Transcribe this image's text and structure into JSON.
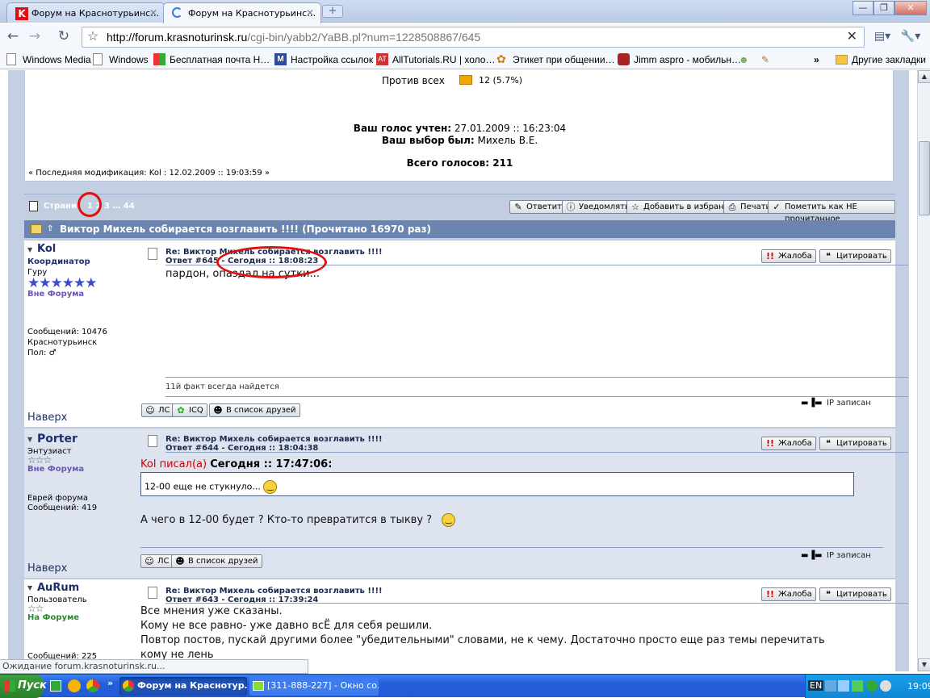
{
  "browser": {
    "tabs": [
      {
        "label": "Форум на Краснотурьинс…",
        "active": false
      },
      {
        "label": "Форум на Краснотурьинс…",
        "active": true
      }
    ],
    "url_host": "http://forum.krasnoturinsk.ru",
    "url_path": "/cgi-bin/yabb2/YaBB.pl?num=1228508867/645",
    "bookmarks": [
      "Windows Media",
      "Windows",
      "Бесплатная почта Н…",
      "Настройка ссылок",
      "AllTutorials.RU | холо…",
      "Этикет при общении…",
      "Jimm aspro - мобильн…",
      "»",
      "Другие закладки"
    ]
  },
  "poll": {
    "option_label": "Против всех",
    "option_value": "12 (5.7%)",
    "option_fraction": 0.057,
    "vote_counted_label": "Ваш голос учтен:",
    "vote_counted_value": "27.01.2009 :: 16:23:04",
    "choice_label": "Ваш выбор был:",
    "choice_value": "Михель В.Е.",
    "total_label": "Всего голосов:",
    "total_value": "211",
    "last_mod": "« Последняя модификация: Kol : 12.02.2009 :: 19:03:59 »"
  },
  "pagenav": {
    "label": "Страни",
    "pages": "1 2 3 … 44",
    "buttons": [
      "Ответить",
      "Уведомлять",
      "Добавить в избранное",
      "Печать",
      "Пометить как НЕ прочитанное"
    ]
  },
  "topic": {
    "title": "Виктор Михель собирается возглавить !!!! (Прочитано 16970 раз)"
  },
  "posts": [
    {
      "user": "Kol",
      "role": "Координатор",
      "rank": "Гуру",
      "status": "Вне Форума",
      "messages": "Сообщений: 10476",
      "city": "Краснотурьинск",
      "gender": "Пол: ♂",
      "title": "Re: Виктор Михель собирается возглавить !!!!",
      "reply": "Ответ #645 - Сегодня :: 18:08:23",
      "body": "пардон, опаздал на сутки...",
      "signature": "11й факт всегда найдется",
      "nav": "Наверх",
      "ip": "IP записан",
      "actions": [
        "ЛС",
        "ICQ",
        "В список друзей"
      ]
    },
    {
      "user": "Porter",
      "role": "Энтузиаст",
      "status": "Вне Форума",
      "extra": "Еврей форума",
      "messages": "Сообщений: 419",
      "title": "Re: Виктор Михель собирается возглавить !!!!",
      "reply": "Ответ #644 - Сегодня :: 18:04:38",
      "quote_author": "Kol писал(а)",
      "quote_time": "Сегодня :: 17:47:06:",
      "quote_text": "12-00 еще не стукнуло...",
      "body": "А чего в 12-00 будет ? Кто-то превратится в тыкву ?",
      "nav": "Наверх",
      "ip": "IP записан",
      "actions": [
        "ЛС",
        "В список друзей"
      ]
    },
    {
      "user": "AuRum",
      "role": "Пользователь",
      "status": "На Форуме",
      "messages": "Сообщений: 225",
      "title": "Re: Виктор Михель собирается возглавить !!!!",
      "reply": "Ответ #643 - Сегодня :: 17:39:24",
      "body_lines": [
        "Все мнения уже сказаны.",
        "Кому не все равно- уже давно всЁ для себя решили.",
        "Повтор постов, пускай другими более \"убедительными\" словами, не к чему. Достаточно просто еще раз темы перечитать",
        "кому не лень"
      ]
    }
  ],
  "post_buttons": {
    "complaint": "Жалоба",
    "quote": "Цитировать"
  },
  "status_text": "Ожидание forum.krasnoturinsk.ru...",
  "taskbar": {
    "start": "Пуск",
    "tasks": [
      "Форум на Краснотур…",
      "[311-888-227] - Окно со…"
    ],
    "lang": "EN",
    "clock": "19:09"
  }
}
